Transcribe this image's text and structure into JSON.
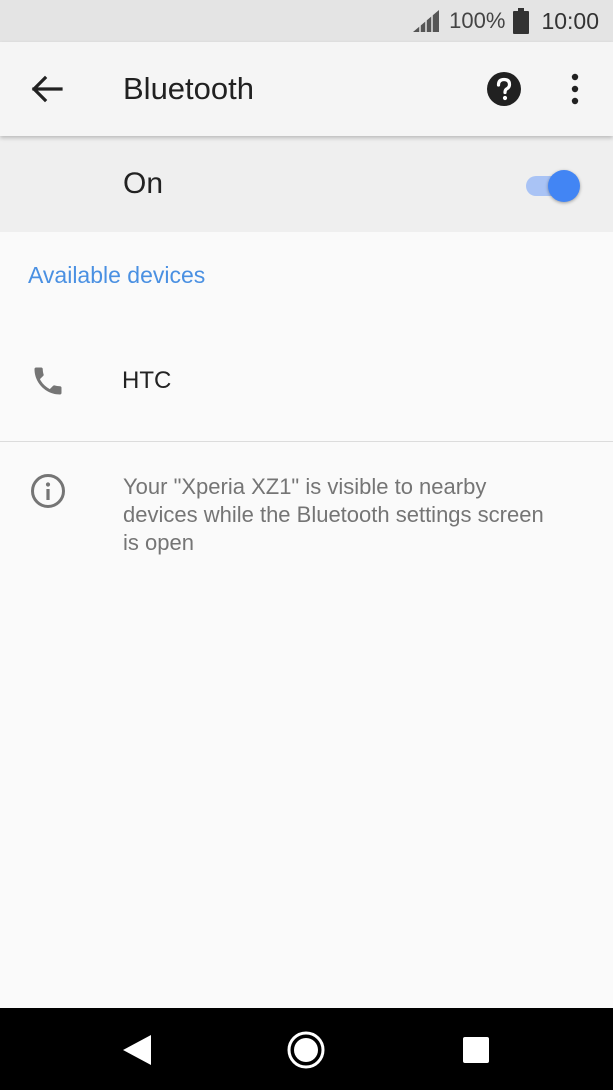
{
  "status_bar": {
    "battery_percent": "100%",
    "time": "10:00",
    "icons": [
      "signal-icon",
      "battery-icon"
    ]
  },
  "app_bar": {
    "title": "Bluetooth",
    "icons": [
      "back-arrow-icon",
      "help-icon",
      "more-vert-icon"
    ]
  },
  "bluetooth_switch": {
    "label": "On",
    "state": true
  },
  "available_devices": {
    "header": "Available devices",
    "items": [
      {
        "name": "HTC",
        "icon": "phone-icon"
      }
    ]
  },
  "info": {
    "icon": "info-icon",
    "text": "Your \"Xperia XZ1\" is visible to nearby devices while the Bluetooth settings screen is open"
  },
  "nav_bar": {
    "icons": [
      "nav-back-icon",
      "nav-home-icon",
      "nav-recents-icon"
    ]
  },
  "colors": {
    "accent": "#4285f4",
    "section_header": "#4a90e2",
    "toggle_track": "#a9c3f5",
    "status_bar_bg": "#e4e4e4",
    "app_bar_bg": "#f5f5f5",
    "switch_bar_bg": "#efefef",
    "page_bg": "#fafafa",
    "nav_bar_bg": "#000000"
  }
}
